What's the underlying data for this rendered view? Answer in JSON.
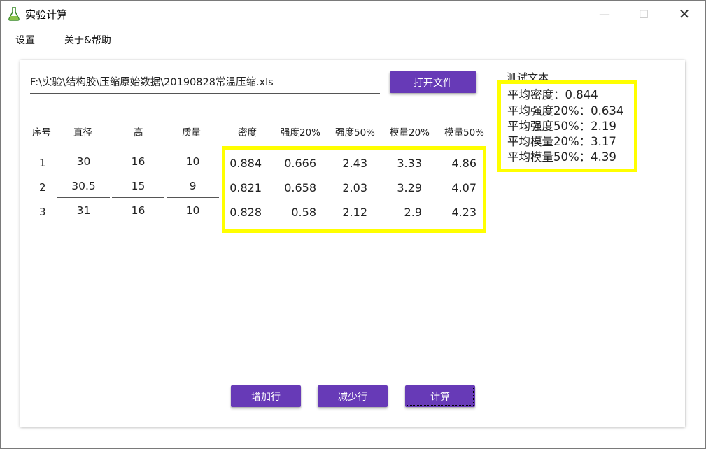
{
  "window": {
    "title": "实验计算",
    "minimize_glyph": "—",
    "maximize_glyph": "☐",
    "close_glyph": "✕"
  },
  "menu": {
    "settings": "设置",
    "help": "关于&帮助"
  },
  "file": {
    "path": "F:\\实验\\结构胶\\压缩原始数据\\20190828常温压缩.xls",
    "open_button": "打开文件"
  },
  "table": {
    "headers": {
      "index": "序号",
      "diameter": "直径",
      "height": "高",
      "mass": "质量",
      "density": "密度",
      "strength20": "强度20%",
      "strength50": "强度50%",
      "modulus20": "模量20%",
      "modulus50": "模量50%"
    },
    "rows": [
      {
        "index": "1",
        "diameter": "30",
        "height": "16",
        "mass": "10",
        "density": "0.884",
        "strength20": "0.666",
        "strength50": "2.43",
        "modulus20": "3.33",
        "modulus50": "4.86"
      },
      {
        "index": "2",
        "diameter": "30.5",
        "height": "15",
        "mass": "9",
        "density": "0.821",
        "strength20": "0.658",
        "strength50": "2.03",
        "modulus20": "3.29",
        "modulus50": "4.07"
      },
      {
        "index": "3",
        "diameter": "31",
        "height": "16",
        "mass": "10",
        "density": "0.828",
        "strength20": "0.58",
        "strength50": "2.12",
        "modulus20": "2.9",
        "modulus50": "4.23"
      }
    ]
  },
  "summary": {
    "title": "测试文本",
    "avg_density": "平均密度：0.844",
    "avg_strength20": "平均强度20%：0.634",
    "avg_strength50": "平均强度50%：2.19",
    "avg_modulus20": "平均模量20%：3.17",
    "avg_modulus50": "平均模量50%：4.39"
  },
  "buttons": {
    "add_row": "增加行",
    "remove_row": "减少行",
    "calculate": "计算"
  },
  "colors": {
    "button": "#673ab7",
    "highlight": "#ffff00"
  }
}
